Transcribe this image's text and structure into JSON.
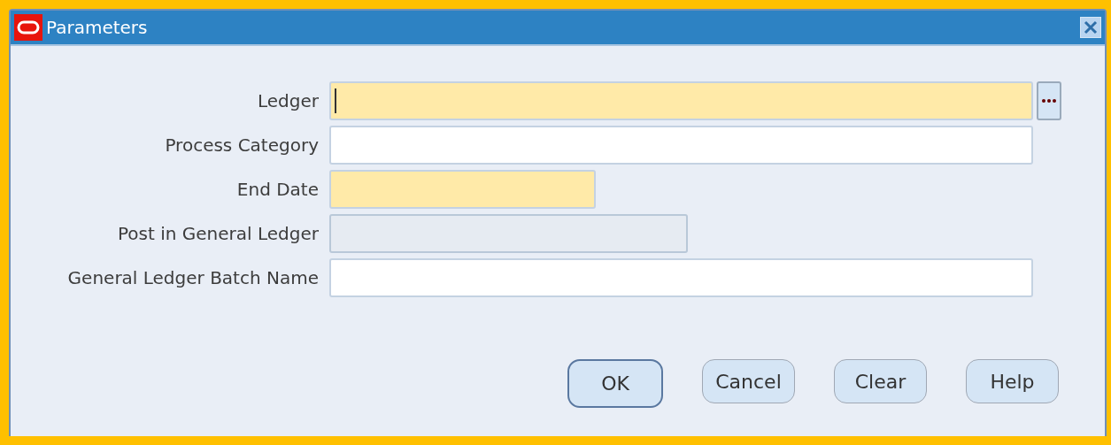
{
  "window": {
    "title": "Parameters"
  },
  "fields": [
    {
      "label": "Ledger",
      "kind": "text",
      "required": true,
      "disabled": false,
      "focused": true,
      "lov": true
    },
    {
      "label": "Process Category",
      "kind": "text",
      "required": false,
      "disabled": false,
      "focused": false,
      "lov": false
    },
    {
      "label": "End Date",
      "kind": "date",
      "required": true,
      "disabled": false,
      "focused": false,
      "lov": false
    },
    {
      "label": "Post in General Ledger",
      "kind": "flag",
      "required": false,
      "disabled": true,
      "focused": false,
      "lov": false
    },
    {
      "label": "General Ledger Batch Name",
      "kind": "text",
      "required": false,
      "disabled": false,
      "focused": false,
      "lov": false
    }
  ],
  "buttons": [
    {
      "label": "OK",
      "default": true
    },
    {
      "label": "Cancel",
      "default": false
    },
    {
      "label": "Clear",
      "default": false
    },
    {
      "label": "Help",
      "default": false
    }
  ]
}
